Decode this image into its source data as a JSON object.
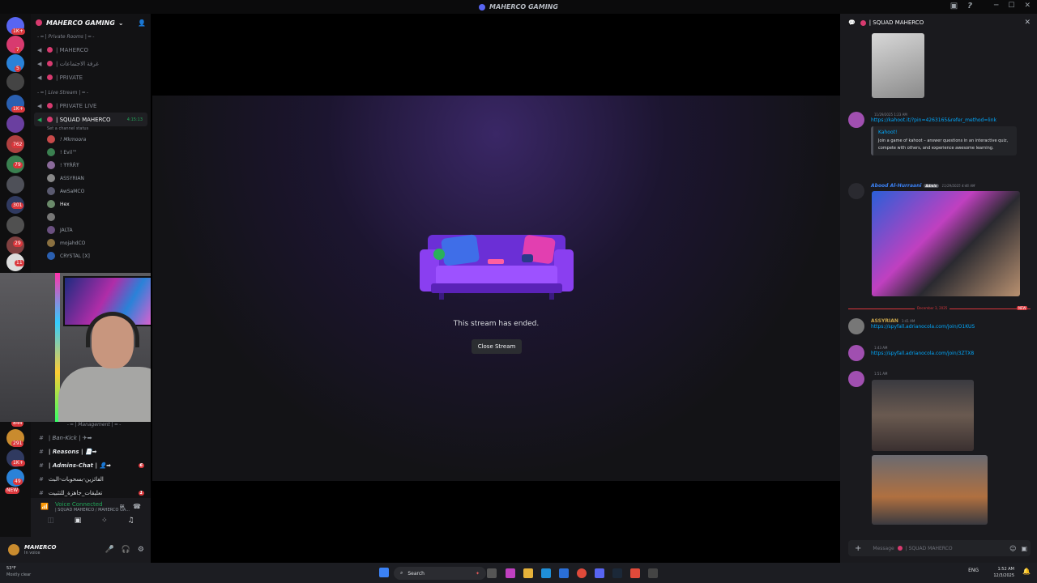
{
  "titlebar": {
    "title": "MAHERCO GAMING"
  },
  "server": {
    "name": "MAHERCO GAMING"
  },
  "rail_badges": [
    "1K+",
    "7",
    "5",
    "1K+",
    "762",
    "79",
    "301",
    "29",
    "11",
    "844",
    "291",
    "1K+",
    "49",
    "NEW"
  ],
  "categories": {
    "private": "- ━ | Private Rooms | ━ -",
    "live": "- ━ | Live Stream | ━ -",
    "management": "- ━ | Management | ━ -"
  },
  "channels": {
    "private": [
      "| MAHERCO",
      "| غرفة الاجتماعات",
      "| PRIVATE"
    ],
    "live": [
      "| PRIVATE LIVE"
    ],
    "active": {
      "name": "| SQUAD MAHERCO",
      "timer": "4:15:13",
      "status": "Set a channel status"
    }
  },
  "members": [
    "! Mkmoora",
    "! Evil™",
    "! ŦŦŔŘŦ",
    "ASSYRIAN",
    "AwSaMCO",
    "Hex",
    "JALTA",
    "mojahdCO",
    "CRYSTAL [X]"
  ],
  "text_channels": [
    {
      "name": "| Ban-Kick | ✈➡",
      "count": ""
    },
    {
      "name": "| Reasons | 📄➡",
      "count": ""
    },
    {
      "name": "| Admins-Chat | 👤➡",
      "count": "6"
    },
    {
      "name": "الفائزين-بسحوبات-البث",
      "count": ""
    },
    {
      "name": "تعليقات_جاهزة_للتثبيت",
      "count": "1"
    }
  ],
  "voice": {
    "status": "Voice Connected",
    "sub": "| SQUAD MAHERCO / MAHERCO GA..."
  },
  "user": {
    "name": "MAHERCO",
    "status": "In voice"
  },
  "stream": {
    "ended_text": "This stream has ended.",
    "close_label": "Close Stream"
  },
  "chat": {
    "title": "| SQUAD MAHERCO",
    "msg1": {
      "time": "11/29/2025 1:23 AM",
      "link": "https://kahoot.it/?pin=4263165&refer_method=link",
      "embed_title": "Kahoot!",
      "embed_desc": "Join a game of kahoot – answer questions in an interactive quiz, compete with others, and experience awesome learning."
    },
    "msg2": {
      "name": "Abood Al-Hurraani",
      "role": "Admin",
      "time": "11/29/2025 4:46 AM"
    },
    "divider": "December 3, 2025",
    "divider_new": "NEW",
    "msg3": {
      "name": "ASSYRIAN",
      "time": "1:41 AM",
      "link": "https://spyfall.adrianocola.com/join/O1KUS"
    },
    "msg4": {
      "time": "1:43 AM",
      "link": "https://spyfall.adrianocola.com/join/3ZTX8"
    },
    "msg5": {
      "time": "1:51 AM"
    },
    "input_placeholder": "Message",
    "input_channel": "| SQUAD MAHERCO"
  },
  "taskbar": {
    "weather_temp": "53°F",
    "weather_desc": "Mostly clear",
    "search": "Search",
    "lang": "ENG",
    "time": "1:52 AM",
    "date": "12/3/2025"
  }
}
